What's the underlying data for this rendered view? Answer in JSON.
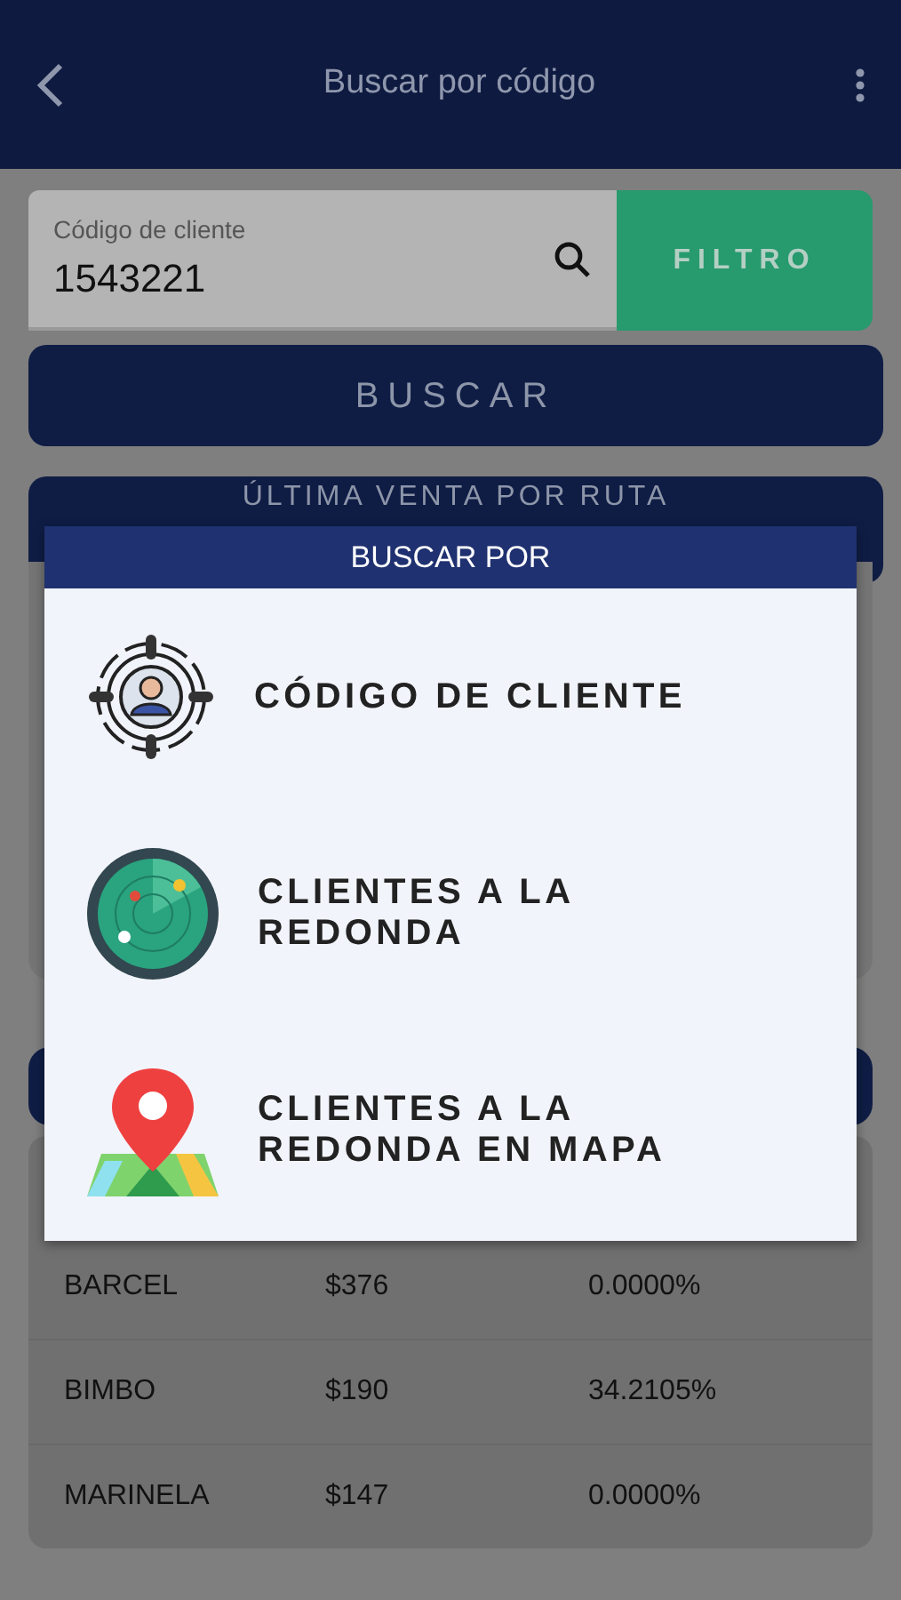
{
  "app_bar": {
    "title": "Buscar por código"
  },
  "search": {
    "label": "Código de cliente",
    "value": "1543221"
  },
  "filter_button": "FILTRO",
  "search_button": "BUSCAR",
  "last_sale_button": "ÚLTIMA VENTA POR RUTA",
  "table": {
    "rows": [
      {
        "brand": "BARCEL",
        "amount": "$376",
        "percent": "0.0000%"
      },
      {
        "brand": "BIMBO",
        "amount": "$190",
        "percent": "34.2105%"
      },
      {
        "brand": "MARINELA",
        "amount": "$147",
        "percent": "0.0000%"
      }
    ]
  },
  "dialog": {
    "title": "BUSCAR POR",
    "options": [
      {
        "kind": "target",
        "label": "CÓDIGO DE CLIENTE"
      },
      {
        "kind": "radar",
        "label": "CLIENTES A LA REDONDA"
      },
      {
        "kind": "map",
        "label": "CLIENTES A LA REDONDA EN MAPA"
      }
    ]
  }
}
